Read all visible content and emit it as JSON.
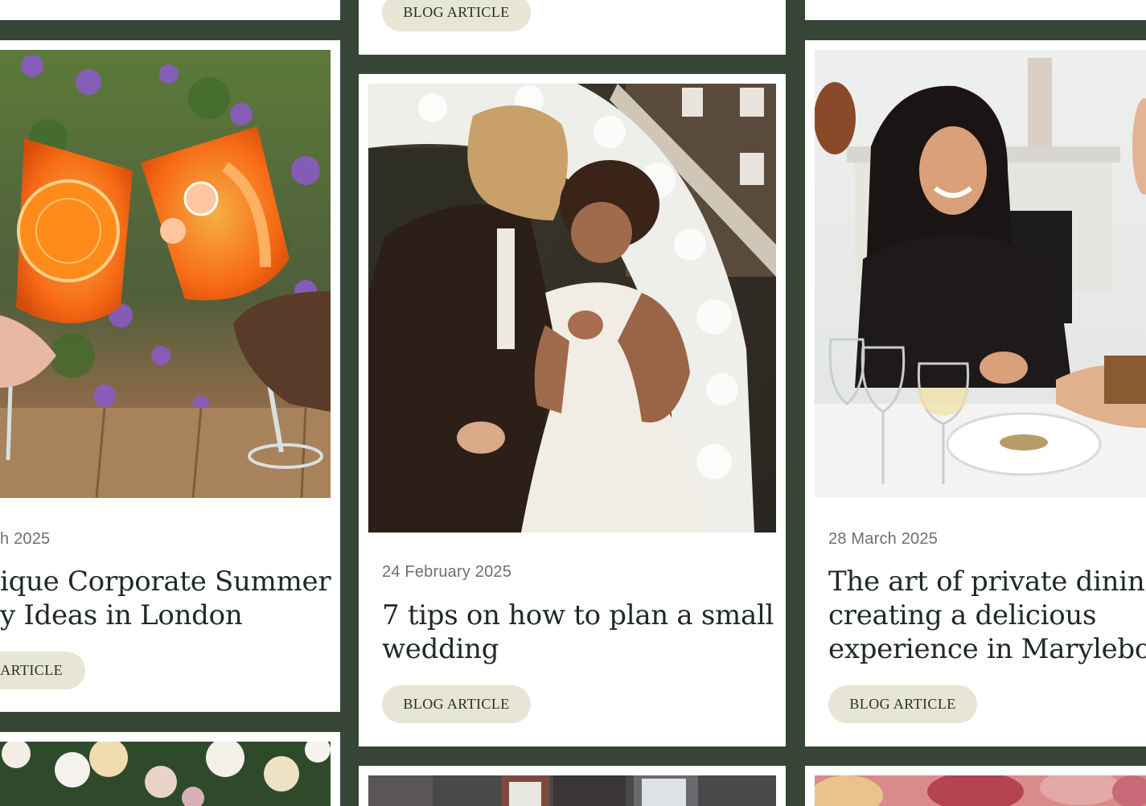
{
  "grid": {
    "card_left_mid": {
      "date": "h 2025",
      "title_line1": "ique Corporate Summer",
      "title_line2": "y Ideas in London",
      "tag": "ARTICLE",
      "image_icon": "cocktail-glasses-photo"
    },
    "card_center_top": {
      "tag": "BLOG ARTICLE"
    },
    "card_center_mid": {
      "date": "24 February 2025",
      "title_line1": "7 tips on how to plan a small",
      "title_line2": "wedding",
      "tag": "BLOG ARTICLE",
      "image_icon": "wedding-couple-photo"
    },
    "card_right_mid": {
      "date": "28 March 2025",
      "title_line1": "The art of private dining",
      "title_line2": "creating a delicious",
      "title_line3": "experience in Marylebone",
      "tag": "BLOG ARTICLE",
      "image_icon": "private-dining-photo"
    },
    "card_left_bottom": {
      "image_icon": "flower-arrangement-photo"
    },
    "card_center_bottom": {
      "image_icon": "brick-building-photo"
    },
    "card_right_bottom": {
      "image_icon": "dessert-photo"
    }
  },
  "colors": {
    "background": "#364536",
    "card": "#ffffff",
    "pill": "#e7e6d4",
    "title_text": "#1e2a22",
    "date_text": "#6f6f6f"
  }
}
